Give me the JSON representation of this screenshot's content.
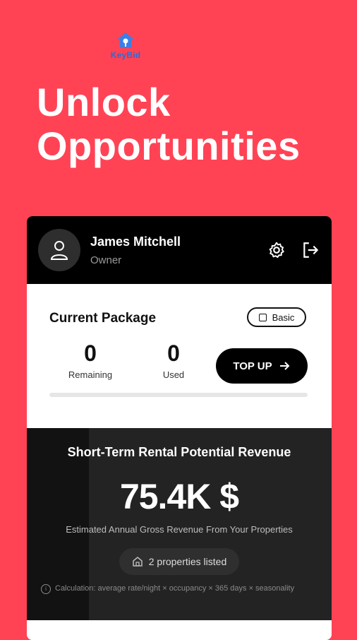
{
  "brand": {
    "name": "KeyBid"
  },
  "headline": {
    "line1": "Unlock",
    "line2": "Opportunities"
  },
  "user": {
    "name": "James Mitchell",
    "role": "Owner"
  },
  "package": {
    "title": "Current Package",
    "plan": "Basic",
    "remaining_value": "0",
    "remaining_label": "Remaining",
    "used_value": "0",
    "used_label": "Used",
    "topup_label": "TOP UP",
    "usage_fraction": 0
  },
  "revenue": {
    "title": "Short-Term Rental Potential Revenue",
    "amount": "75.4K $",
    "subtitle": "Estimated Annual Gross Revenue From Your Properties",
    "properties_chip": "2 properties listed",
    "calculation_note": "Calculation: average rate/night × occupancy × 365 days × seasonality"
  },
  "icons": {
    "logo": "house-key-logo-icon",
    "avatar": "user-icon",
    "settings": "gear-icon",
    "logout": "logout-icon",
    "badge": "checkbox-icon",
    "topup_arrow": "arrow-right-icon",
    "chip": "home-icon",
    "info": "info-icon"
  },
  "colors": {
    "background": "#FF4355",
    "card_dark": "#000000",
    "brand_blue": "#2a6bd8"
  }
}
